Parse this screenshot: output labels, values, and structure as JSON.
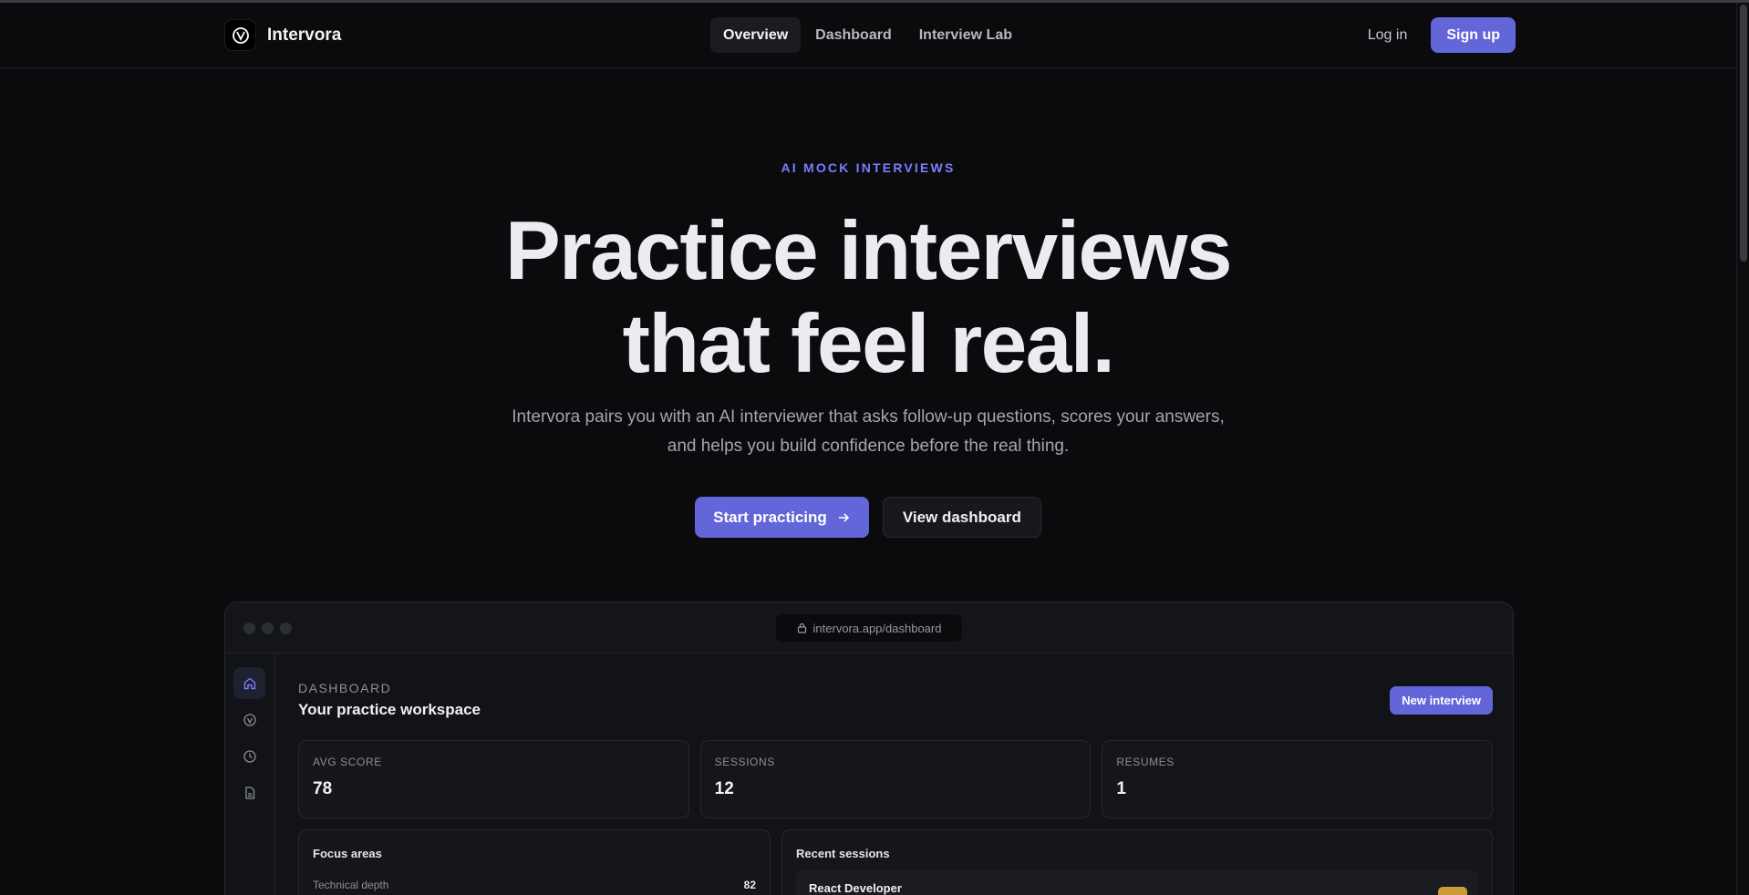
{
  "brand": {
    "name": "Intervora"
  },
  "nav": {
    "items": [
      {
        "label": "Overview",
        "active": true
      },
      {
        "label": "Dashboard",
        "active": false
      },
      {
        "label": "Interview Lab",
        "active": false
      }
    ]
  },
  "auth": {
    "login_label": "Log in",
    "signup_label": "Sign up"
  },
  "hero": {
    "eyebrow": "AI MOCK INTERVIEWS",
    "title_line1": "Practice interviews",
    "title_line2": "that feel real.",
    "subtitle": "Intervora pairs you with an AI interviewer that asks follow-up questions, scores your answers, and helps you build confidence before the real thing.",
    "primary_cta": "Start practicing",
    "secondary_cta": "View dashboard"
  },
  "mock": {
    "url": "intervora.app/dashboard",
    "sidebar_icons": [
      "home-icon",
      "interview-icon",
      "history-icon",
      "document-icon"
    ],
    "eyebrow": "DASHBOARD",
    "title": "Your practice workspace",
    "new_button": "New interview",
    "stats": [
      {
        "label": "AVG SCORE",
        "value": "78"
      },
      {
        "label": "SESSIONS",
        "value": "12"
      },
      {
        "label": "RESUMES",
        "value": "1"
      }
    ],
    "focus": {
      "title": "Focus areas",
      "item_label": "Technical depth",
      "item_score": "82"
    },
    "recent": {
      "title": "Recent sessions",
      "session_name": "React Developer"
    }
  },
  "colors": {
    "accent": "#6366d9",
    "eyebrow": "#7a7dff",
    "background": "#0b0b0d",
    "badge": "#c99b3b"
  }
}
